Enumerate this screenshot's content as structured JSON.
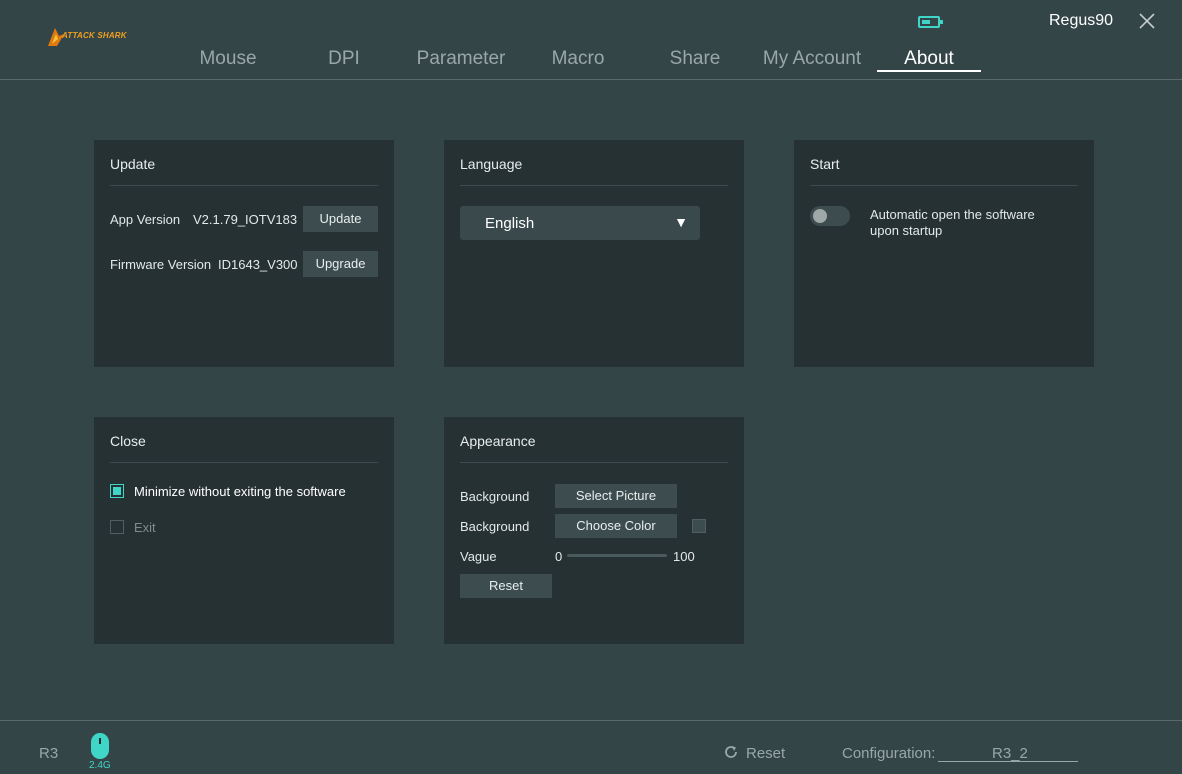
{
  "header": {
    "logo_text": "ATTACK SHARK",
    "device_name": "Regus90",
    "battery_level": 0.35,
    "accent_color": "#3fd6c8",
    "tabs": [
      {
        "label": "Mouse",
        "active": false
      },
      {
        "label": "DPI",
        "active": false
      },
      {
        "label": "Parameter",
        "active": false
      },
      {
        "label": "Macro",
        "active": false
      },
      {
        "label": "Share",
        "active": false
      },
      {
        "label": "My Account",
        "active": false
      },
      {
        "label": "About",
        "active": true
      }
    ]
  },
  "update": {
    "title": "Update",
    "app_version_label": "App Version",
    "app_version": "V2.1.79_IOTV183",
    "update_button": "Update",
    "firmware_label": "Firmware Version",
    "firmware_version": "ID1643_V300",
    "upgrade_button": "Upgrade"
  },
  "language": {
    "title": "Language",
    "selected": "English",
    "arrow": "▼"
  },
  "start": {
    "title": "Start",
    "auto_open_line1": "Automatic open the software",
    "auto_open_line2": "upon startup",
    "auto_open_enabled": false
  },
  "close": {
    "title": "Close",
    "minimize_label": "Minimize without exiting the software",
    "minimize_checked": true,
    "exit_label": "Exit",
    "exit_checked": false
  },
  "appearance": {
    "title": "Appearance",
    "background_label_1": "Background",
    "select_picture_button": "Select Picture",
    "background_label_2": "Background",
    "choose_color_button": "Choose Color",
    "vague_label": "Vague",
    "vague_min": "0",
    "vague_max": "100",
    "vague_value": 0,
    "reset_button": "Reset"
  },
  "footer": {
    "profile": "R3",
    "connection_mode": "2.4G",
    "reset_label": "Reset",
    "configuration_label": "Configuration:",
    "configuration_value": "R3_2"
  }
}
